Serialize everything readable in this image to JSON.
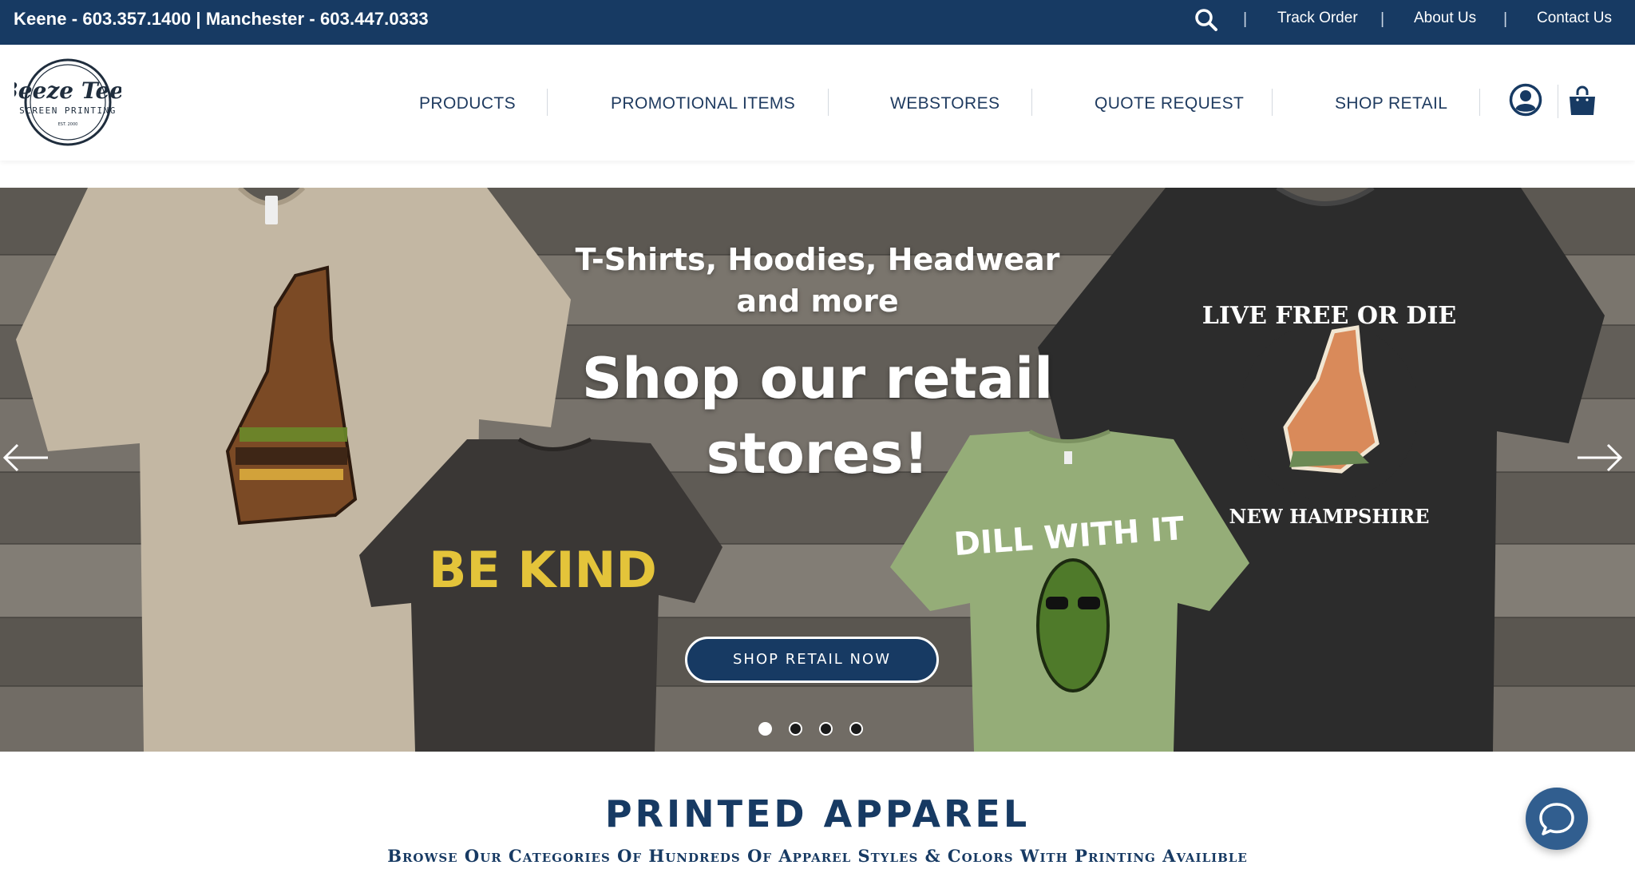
{
  "topbar": {
    "phones": "Keene - 603.357.1400 | Manchester - 603.447.0333",
    "search_icon": "search-icon",
    "links": [
      {
        "label": "Track Order"
      },
      {
        "label": "About Us"
      },
      {
        "label": "Contact Us"
      }
    ]
  },
  "header": {
    "logo": {
      "brand": "Beeze Tees",
      "tagline": "SCREEN PRINTING",
      "est": "EST. 2000"
    },
    "nav": [
      {
        "label": "PRODUCTS"
      },
      {
        "label": "PROMOTIONAL ITEMS"
      },
      {
        "label": "WEBSTORES"
      },
      {
        "label": "QUOTE REQUEST"
      },
      {
        "label": "SHOP RETAIL"
      }
    ],
    "account_icon": "user-account-icon",
    "cart_icon": "shopping-bag-icon"
  },
  "hero": {
    "subheading_line1": "T-Shirts, Hoodies, Headwear",
    "subheading_line2": "and more",
    "heading_line1": "Shop our retail",
    "heading_line2": "stores!",
    "cta_label": "SHOP RETAIL NOW",
    "shirt_prints": {
      "be_kind": "BE KIND",
      "dill_with_it": "DILL WITH IT",
      "live_free_top": "LIVE FREE OR DIE",
      "live_free_bottom": "NEW HAMPSHIRE"
    },
    "slides_total": 4,
    "active_slide": 1
  },
  "section": {
    "title": "PRINTED APPAREL",
    "subtitle": "Browse Our Categories Of Hundreds Of Apparel Styles & Colors With Printing Availible"
  },
  "colors": {
    "navy": "#173a63",
    "chat": "#315e8f",
    "wood": "#6e6a63"
  }
}
